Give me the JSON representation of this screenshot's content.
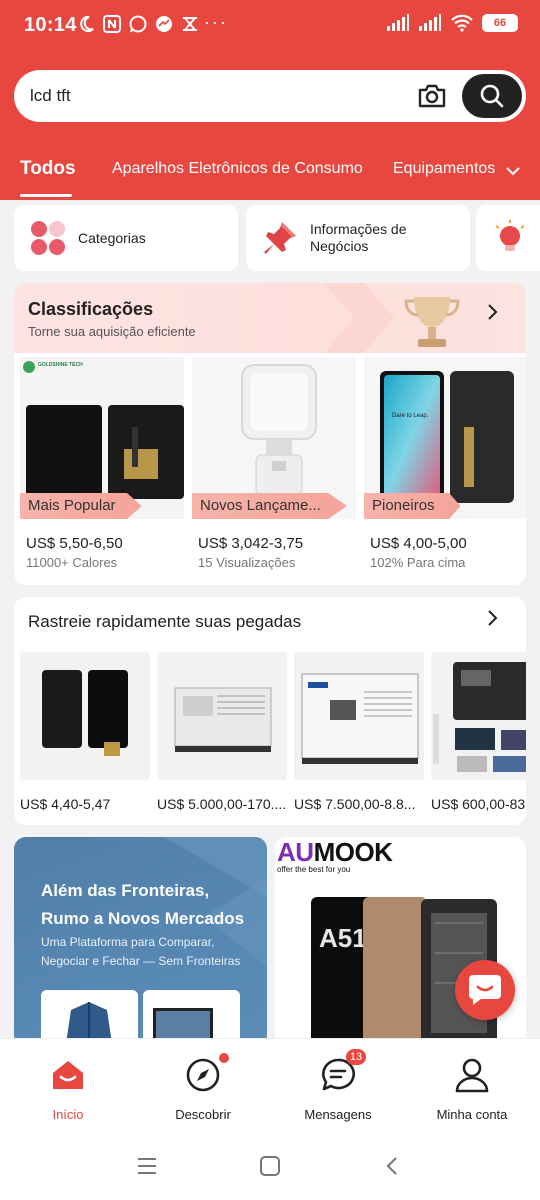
{
  "status_bar": {
    "time": "10:14",
    "dots": "···",
    "battery": "66"
  },
  "search": {
    "value": "lcd tft"
  },
  "tabs": [
    {
      "label": "Todos",
      "active": true
    },
    {
      "label": "Aparelhos Eletrônicos de Consumo"
    },
    {
      "label": "Equipamentos"
    }
  ],
  "quick_links": [
    {
      "label": "Categorias",
      "icon": "categories-icon"
    },
    {
      "label": "Informações de Negócios",
      "icon": "pushpin-icon"
    },
    {
      "label": "",
      "icon": "lightbulb-icon"
    }
  ],
  "rankings": {
    "title": "Classificações",
    "subtitle": "Torne sua aquisição eficiente",
    "items": [
      {
        "tag": "Mais Popular",
        "price": "US$ 5,50-6,50",
        "meta": "11000+ Calores",
        "brand": "GOLDSHINE TECH"
      },
      {
        "tag": "Novos Lançame...",
        "price": "US$ 3,042-3,75",
        "meta": "15 Visualizações"
      },
      {
        "tag": "Pioneiros",
        "price": "US$ 4,00-5,00",
        "meta": "102% Para cima",
        "screen_text": "Dare to Leap."
      }
    ]
  },
  "footprints": {
    "title": "Rastreie rapidamente suas pegadas",
    "items": [
      {
        "price": "US$ 4,40-5,47"
      },
      {
        "price": "US$ 5.000,00-170...."
      },
      {
        "price": "US$ 7.500,00-8.8..."
      },
      {
        "price": "US$ 600,00-83"
      }
    ]
  },
  "banner_blue": {
    "title": "Além das Fronteiras, Rumo a Novos Mercados",
    "subtitle": "Uma Plataforma para Comparar, Negociar e Fechar — Sem Fronteiras"
  },
  "banner_white": {
    "brand_a": "AU",
    "brand_b": "MOOK",
    "tagline": "offer the best for you",
    "model": "A51"
  },
  "bottom_nav": [
    {
      "label": "Início",
      "active": true
    },
    {
      "label": "Descobrir",
      "dot": true
    },
    {
      "label": "Mensagens",
      "badge": "13"
    },
    {
      "label": "Minha conta"
    }
  ],
  "colors": {
    "brand_red": "#e8473f",
    "dark": "#222222"
  }
}
